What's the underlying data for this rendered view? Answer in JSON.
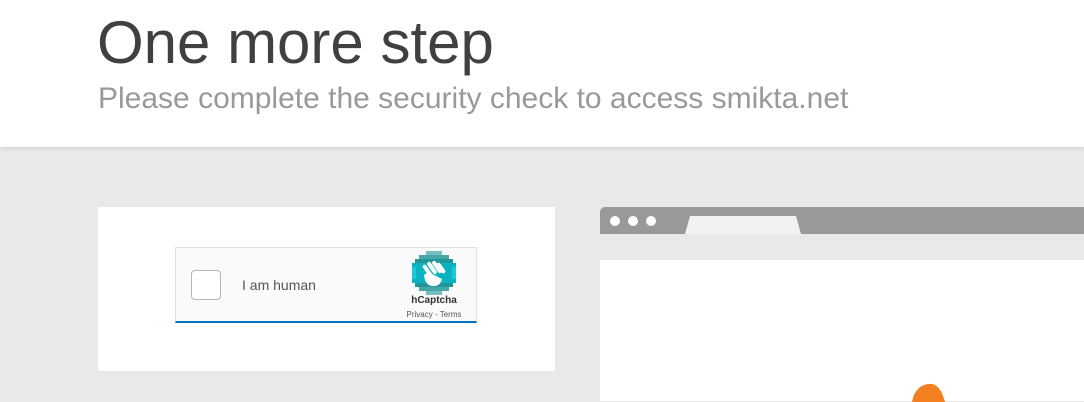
{
  "header": {
    "title": "One more step",
    "subtitle": "Please complete the security check to access smikta.net"
  },
  "captcha": {
    "label": "I am human",
    "brand": "hCaptcha",
    "privacy_link": "Privacy",
    "separator": " - ",
    "terms_link": "Terms",
    "checked": false
  },
  "icons": {
    "hcaptcha_logo": "hcaptcha-hand-icon",
    "browser_dots": "window-dots-icon",
    "illustration": "cloudflare-cloud-icon"
  },
  "colors": {
    "accent_blue": "#0074bf",
    "title_text": "#404040",
    "subtitle_text": "#999999",
    "page_bg": "#e9e9e9",
    "browser_chrome": "#999999",
    "cloud_orange": "#f38020"
  }
}
